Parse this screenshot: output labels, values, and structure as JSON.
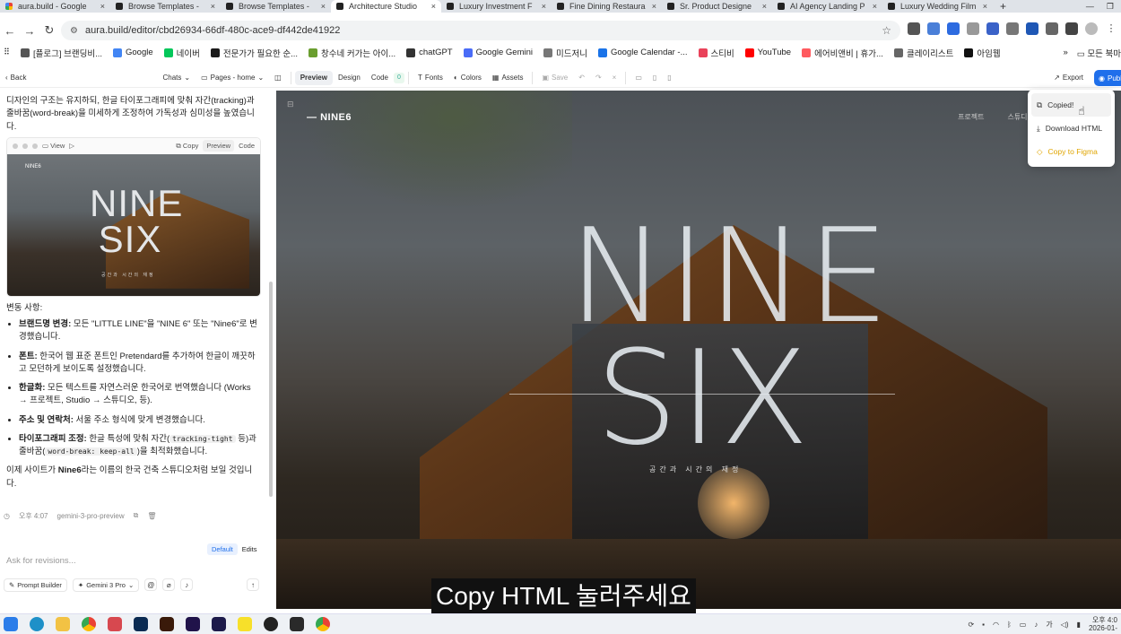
{
  "browser": {
    "tabs": [
      {
        "title": "aura.build - Google",
        "favicon": "google"
      },
      {
        "title": "Browse Templates - ",
        "favicon": "aura"
      },
      {
        "title": "Browse Templates - ",
        "favicon": "aura"
      },
      {
        "title": "Architecture Studio",
        "favicon": "aura",
        "active": true
      },
      {
        "title": "Luxury Investment F",
        "favicon": "aura"
      },
      {
        "title": "Fine Dining Restaura",
        "favicon": "aura"
      },
      {
        "title": "Sr. Product Designe",
        "favicon": "aura"
      },
      {
        "title": "AI Agency Landing P",
        "favicon": "aura"
      },
      {
        "title": "Luxury Wedding Film",
        "favicon": "aura"
      }
    ],
    "new_tab": "+",
    "url": "aura.build/editor/cbd26934-66df-480c-ace9-df442de41922",
    "bookmarks": [
      "[플로그] 브랜딩비...",
      "Google",
      "네이버",
      "전문가가 필요한 순...",
      "창수네 커가는 아이...",
      "chatGPT",
      "Google Gemini",
      "미드저니",
      "Google Calendar -...",
      "스티비",
      "YouTube",
      "에어비앤비 | 휴가...",
      "클레이리스트",
      "아임웹"
    ],
    "bookmarks_more": "»",
    "all_bookmarks": "모든 북마"
  },
  "toolbar": {
    "back": "Back",
    "chats": "Chats",
    "pages": "Pages - home",
    "tabs": [
      "Preview",
      "Design",
      "Code"
    ],
    "badge": "0",
    "fonts": "Fonts",
    "colors": "Colors",
    "assets": "Assets",
    "save": "Save",
    "export": "Export",
    "publish": "Publ"
  },
  "chat": {
    "intro": "디자인의 구조는 유지하되, 한글 타이포그래피에 맞춰 자간(tracking)과 줄바꿈(word-break)을 미세하게 조정하여 가독성과 심미성을 높였습니다.",
    "preview_card": {
      "view": "View",
      "copy": "Copy",
      "preview": "Preview",
      "code": "Code",
      "logo": "NINE6",
      "word1": "NINE",
      "word2": "SIX",
      "sub": "공간과 시간의 재정"
    },
    "changes_title": "변동 사항:",
    "changes": [
      {
        "label": "브랜드명 변경:",
        "text": " 모든 \"LITTLE LINE\"을 \"NINE 6\" 또는 \"Nine6\"로 변경했습니다."
      },
      {
        "label": "폰트:",
        "text": " 한국어 웹 표준 폰트인 Pretendard를 추가하여 한글이 깨끗하고 모던하게 보이도록 설정했습니다."
      },
      {
        "label": "한글화:",
        "text": " 모든 텍스트를 자연스러운 한국어로 번역했습니다 (Works → 프로젝트, Studio → 스튜디오, 등)."
      },
      {
        "label": "주소 및 연락처:",
        "text": " 서울 주소 형식에 맞게 변경했습니다."
      },
      {
        "label": "타이포그래피 조정:",
        "text_a": " 한글 특성에 맞춰 자간(",
        "code_a": "tracking-tight",
        "text_b": " 등)과 줄바꿈(",
        "code_b": "word-break: keep-all",
        "text_c": ")을 최적화했습니다."
      }
    ],
    "closing_a": "이제 사이트가 ",
    "closing_bold": "Nine6",
    "closing_b": "라는 이름의 한국 건축 스튜디오처럼 보일 것입니다.",
    "time": "오후 4:07",
    "model": "gemini-3-pro-preview"
  },
  "input": {
    "tab_default": "Default",
    "tab_edits": "Edits",
    "placeholder": "Ask for revisions...",
    "prompt_builder": "Prompt Builder",
    "model_select": "Gemini 3 Pro"
  },
  "preview": {
    "logo": "NINE6",
    "nav": [
      "프로젝트",
      "스튜디"
    ],
    "word1": "NINE",
    "word2": "SIX",
    "subtitle": "공간과 시간의 재정"
  },
  "export_menu": {
    "items": [
      "Copied!",
      "Download HTML",
      "Copy to Figma"
    ]
  },
  "caption": "Copy HTML 눌러주세요",
  "taskbar": {
    "lang": "가",
    "time": "오후 4:0",
    "date": "2026-01-"
  }
}
